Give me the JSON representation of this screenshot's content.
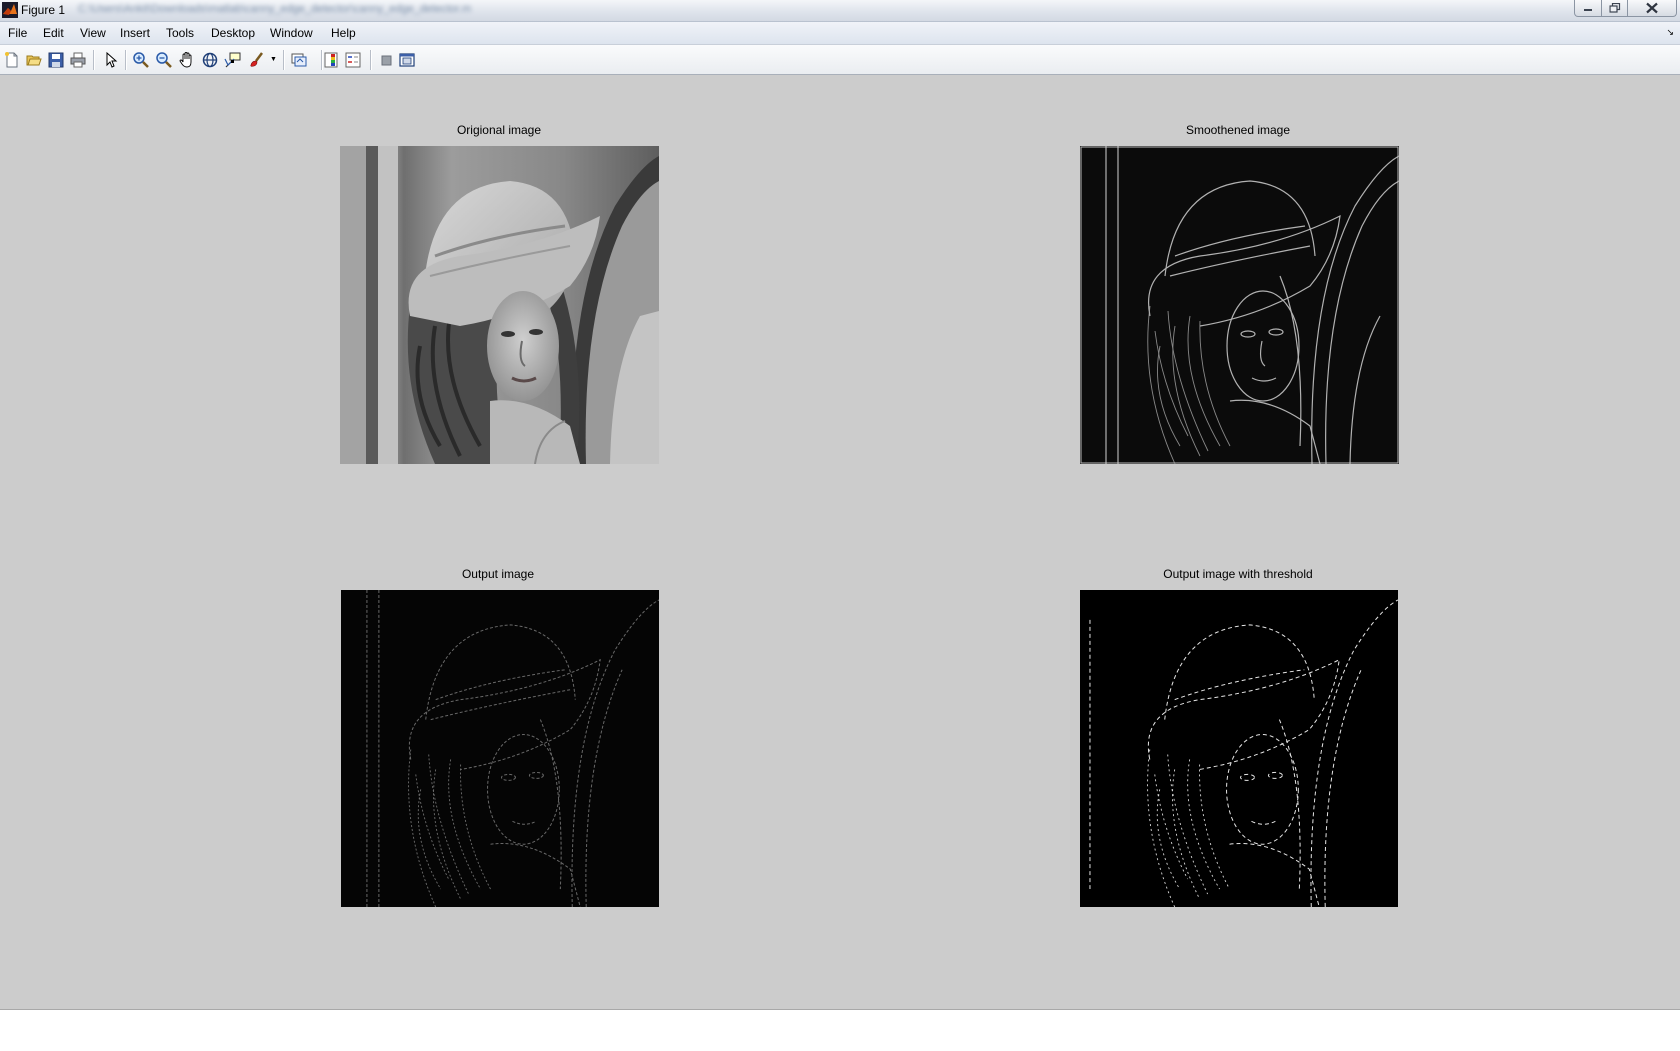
{
  "window": {
    "title": "Figure 1",
    "path_blurred": "C:\\Users\\Ankit\\Downloads\\matlab\\canny_edge_detector\\canny_edge_detector.m",
    "controls": [
      "minimize",
      "maximize",
      "close"
    ]
  },
  "menu": {
    "items": [
      "File",
      "Edit",
      "View",
      "Insert",
      "Tools",
      "Desktop",
      "Window",
      "Help"
    ]
  },
  "toolbar": {
    "buttons": [
      {
        "icon": "new-figure-icon"
      },
      {
        "icon": "open-file-icon"
      },
      {
        "icon": "save-icon"
      },
      {
        "icon": "print-icon"
      },
      {
        "icon": "edit-plot-arrow-icon"
      },
      {
        "icon": "zoom-in-icon"
      },
      {
        "icon": "zoom-out-icon"
      },
      {
        "icon": "pan-hand-icon"
      },
      {
        "icon": "rotate-3d-icon"
      },
      {
        "icon": "data-cursor-icon"
      },
      {
        "icon": "brush-icon"
      },
      {
        "icon": "link-plot-icon"
      },
      {
        "icon": "insert-colorbar-icon"
      },
      {
        "icon": "insert-legend-icon"
      },
      {
        "icon": "hide-plot-tools-icon"
      },
      {
        "icon": "show-plot-tools-icon"
      }
    ]
  },
  "panels": [
    {
      "title": "Origional image",
      "style": "grayscale"
    },
    {
      "title": "Smoothened image",
      "style": "edges-gray"
    },
    {
      "title": "Output image",
      "style": "edges-faint"
    },
    {
      "title": "Output image with threshold",
      "style": "edges-binary"
    }
  ],
  "colors": {
    "figure_bg": "#cccccc",
    "image_black": "#000000",
    "edge_white": "#ffffff"
  }
}
